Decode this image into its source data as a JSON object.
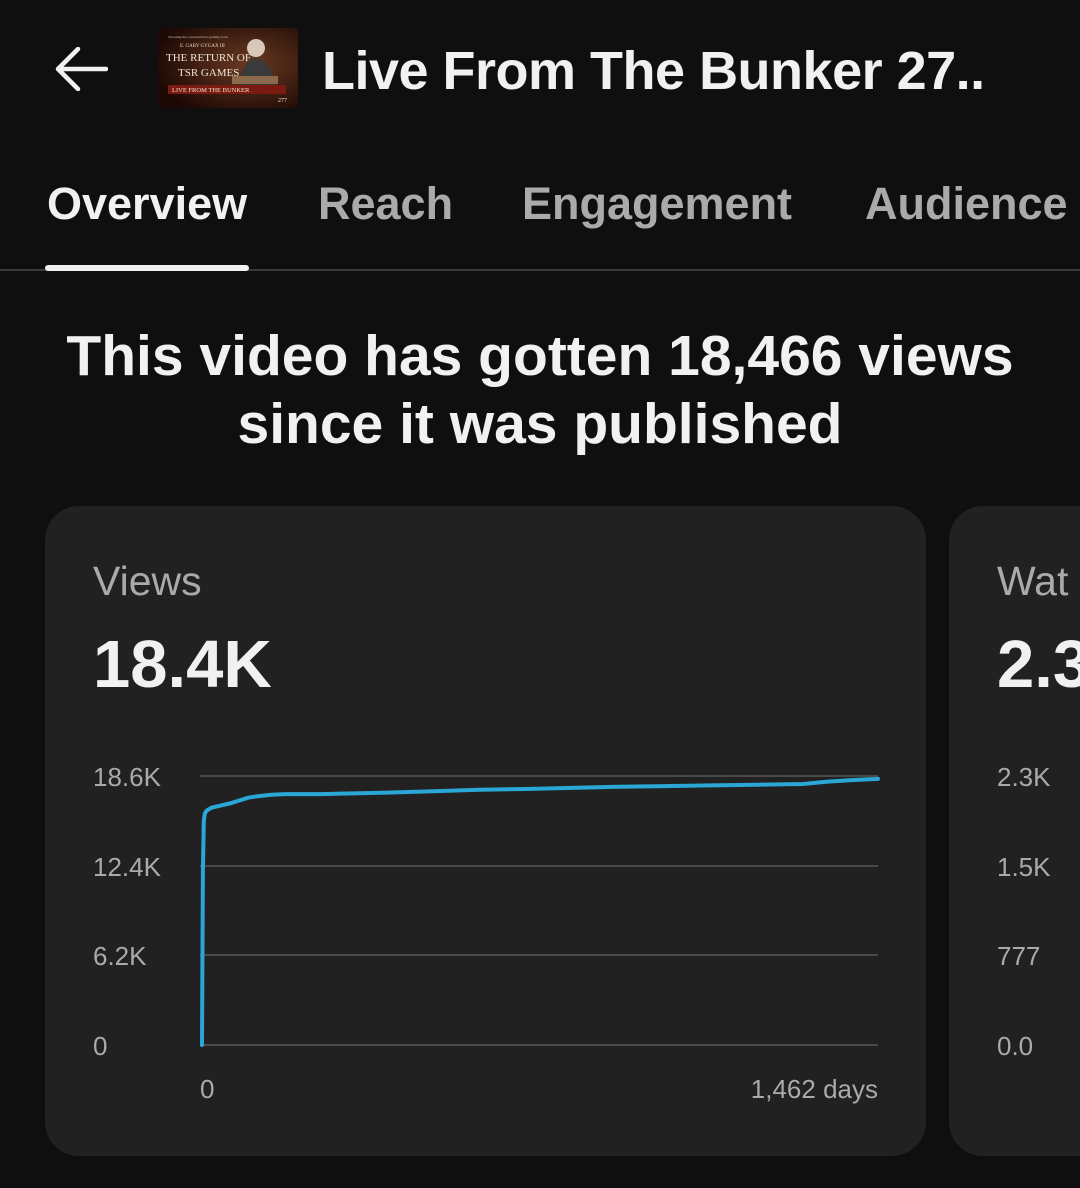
{
  "header": {
    "back_icon": "arrow-left-icon",
    "title": "Live From The Bunker 27..",
    "thumbnail": {
      "top_line": "Choosing the conversation is gaining form",
      "line1": "E. GARY GYGAX III",
      "line2": "THE RETURN OF",
      "line3": "TSR GAMES",
      "banner": "LIVE FROM THE BUNKER",
      "episode": "277"
    }
  },
  "tabs": [
    {
      "label": "Overview",
      "active": true
    },
    {
      "label": "Reach",
      "active": false
    },
    {
      "label": "Engagement",
      "active": false
    },
    {
      "label": "Audience",
      "active": false
    }
  ],
  "headline": {
    "line1": "This video has gotten 18,466 views",
    "line2": "since it was published"
  },
  "cards": [
    {
      "label": "Views",
      "value": "18.4K",
      "y_ticks": [
        "18.6K",
        "12.4K",
        "6.2K",
        "0"
      ],
      "x_ticks": [
        "0",
        "1,462 days"
      ]
    },
    {
      "label": "Wat",
      "value": "2.3",
      "y_ticks": [
        "2.3K",
        "1.5K",
        "777",
        "0.0"
      ]
    }
  ],
  "colors": {
    "background": "#0f0f0f",
    "card": "#212121",
    "line": "#2aa7d6",
    "grid": "#4a4a4a"
  },
  "chart_data": {
    "type": "line",
    "title": "Views",
    "xlabel": "days",
    "ylabel": "",
    "xlim": [
      0,
      1462
    ],
    "ylim": [
      0,
      18600
    ],
    "grid": true,
    "series": [
      {
        "x": [
          0,
          2,
          4,
          6,
          10,
          20,
          40,
          60,
          80,
          100,
          120,
          150,
          180,
          220,
          260,
          300,
          400,
          500,
          600,
          700,
          800,
          900,
          1000,
          1100,
          1200,
          1300,
          1350,
          1400,
          1462
        ],
        "values": [
          0,
          12000,
          15500,
          16000,
          16200,
          16400,
          16550,
          16700,
          16900,
          17100,
          17200,
          17300,
          17350,
          17350,
          17350,
          17380,
          17450,
          17550,
          17650,
          17700,
          17780,
          17850,
          17900,
          17950,
          18000,
          18050,
          18200,
          18300,
          18400
        ]
      }
    ]
  }
}
